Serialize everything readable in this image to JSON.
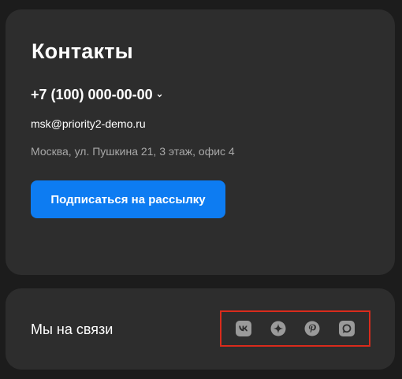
{
  "contacts": {
    "title": "Контакты",
    "phone": "+7 (100) 000-00-00",
    "email": "msk@priority2-demo.ru",
    "address": "Москва, ул. Пушкина 21, 3 этаж, офис 4",
    "subscribe_label": "Подписаться на рассылку"
  },
  "social": {
    "label": "Мы на связи",
    "icons": [
      "vk-icon",
      "sparkle-icon",
      "pinterest-icon",
      "chat-icon"
    ]
  },
  "colors": {
    "background": "#1c1c1c",
    "card": "#2d2d2d",
    "accent": "#0d7cf2",
    "highlight": "#d92b1c",
    "icon": "#9a9a9a"
  }
}
